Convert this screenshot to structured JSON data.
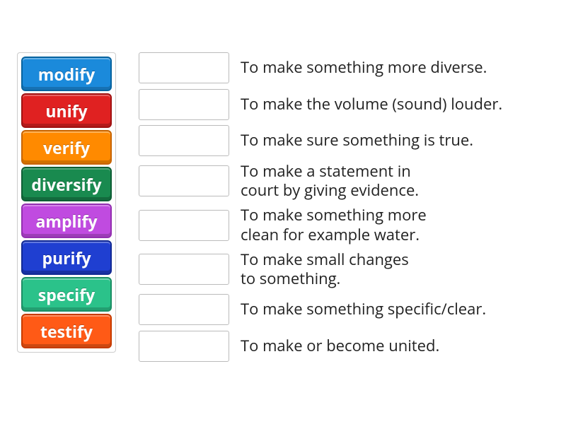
{
  "wordBank": [
    {
      "label": "modify",
      "colorClass": "c-blue"
    },
    {
      "label": "unify",
      "colorClass": "c-red"
    },
    {
      "label": "verify",
      "colorClass": "c-orange"
    },
    {
      "label": "diversify",
      "colorClass": "c-green"
    },
    {
      "label": "amplify",
      "colorClass": "c-magenta"
    },
    {
      "label": "purify",
      "colorClass": "c-royal"
    },
    {
      "label": "specify",
      "colorClass": "c-mint"
    },
    {
      "label": "testify",
      "colorClass": "c-fire"
    }
  ],
  "definitions": [
    {
      "text": "To make something more diverse."
    },
    {
      "text": "To make the volume (sound) louder."
    },
    {
      "text": "To make sure something is true."
    },
    {
      "text": "To make a statement in court by giving evidence."
    },
    {
      "text": "To make something more clean for example water."
    },
    {
      "text": "To make small changes to something."
    },
    {
      "text": "To make something specific/clear."
    },
    {
      "text": "To make or become united."
    }
  ]
}
